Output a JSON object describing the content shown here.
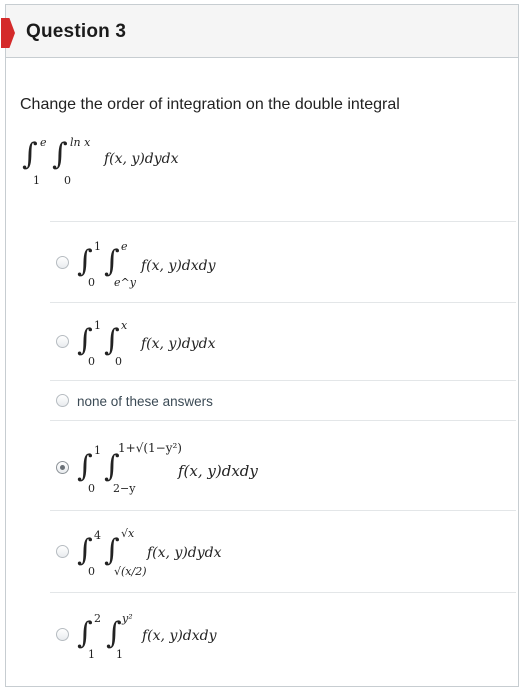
{
  "question": {
    "title": "Question 3",
    "prompt": "Change the order of integration on the double integral",
    "integral": {
      "outer_lower": "1",
      "outer_upper": "e",
      "inner_lower": "0",
      "inner_upper": "ln x",
      "integrand": "f(x, y)dydx"
    }
  },
  "options": [
    {
      "id": "opt1",
      "selected": false,
      "outer_lower": "0",
      "outer_upper": "1",
      "inner_lower": "e^y",
      "inner_upper": "e",
      "integrand": "f(x, y)dxdy"
    },
    {
      "id": "opt2",
      "selected": false,
      "outer_lower": "0",
      "outer_upper": "1",
      "inner_lower": "0",
      "inner_upper": "x",
      "integrand": "f(x, y)dydx"
    },
    {
      "id": "opt3",
      "selected": false,
      "text": "none of these answers"
    },
    {
      "id": "opt4",
      "selected": true,
      "outer_lower": "0",
      "outer_upper": "1",
      "inner_lower": "2−y",
      "inner_upper": "1+√(1−y²)",
      "integrand": "f(x, y)dxdy"
    },
    {
      "id": "opt5",
      "selected": false,
      "outer_lower": "0",
      "outer_upper": "4",
      "inner_lower": "√(x/2)",
      "inner_upper": "√x",
      "integrand": "f(x, y)dydx"
    },
    {
      "id": "opt6",
      "selected": false,
      "outer_lower": "1",
      "outer_upper": "2",
      "inner_lower": "1",
      "inner_upper": "y²",
      "integrand": "f(x, y)dxdy"
    }
  ],
  "colors": {
    "badge": "#d42a2a",
    "header_bg": "#f5f5f5",
    "border": "#c7cdd1"
  }
}
